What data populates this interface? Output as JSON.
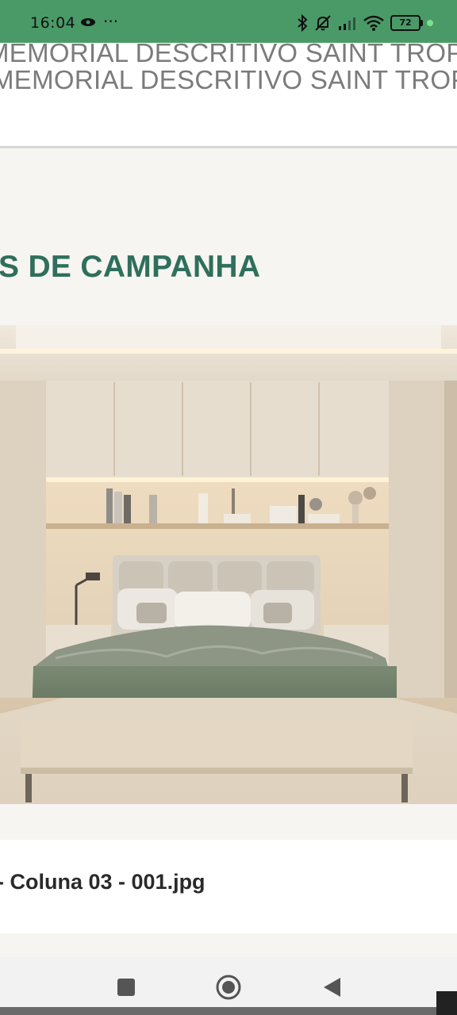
{
  "status_bar": {
    "time": "16:04",
    "overflow": "···",
    "battery": "72",
    "icons": [
      "eye-icon",
      "bluetooth-icon",
      "bell-off-icon",
      "signal-icon",
      "wifi-icon",
      "battery-icon"
    ]
  },
  "document": {
    "title_line_1": "MEMORIAL DESCRITIVO SAINT TROPEZ",
    "title_line_2": "MEMORIAL DESCRITIVO SAINT TROPEZ"
  },
  "section": {
    "title": "S DE CAMPANHA"
  },
  "image": {
    "caption": "- Coluna 03 - 001.jpg",
    "subject": "bedroom interior render"
  },
  "nav_bar": {
    "buttons": [
      "recent-apps",
      "home",
      "back"
    ]
  },
  "colors": {
    "status_bar": "#4a9a68",
    "section_title": "#2f6f5c",
    "page_bg": "#f7f5f1"
  }
}
